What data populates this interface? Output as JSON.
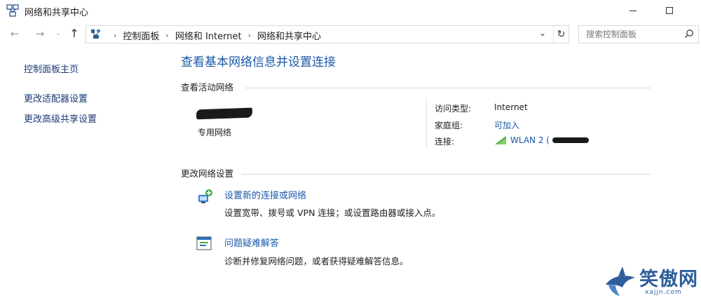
{
  "window": {
    "title": "网络和共享中心"
  },
  "address_bar": {
    "breadcrumbs": [
      "控制面板",
      "网络和 Internet",
      "网络和共享中心"
    ]
  },
  "search": {
    "placeholder": "搜索控制面板"
  },
  "left_nav": {
    "home": "控制面板主页",
    "change_adapter": "更改适配器设置",
    "change_sharing": "更改高级共享设置"
  },
  "main": {
    "title": "查看基本网络信息并设置连接",
    "active_networks_header": "查看活动网络",
    "network": {
      "type": "专用网络",
      "access_type_label": "访问类型:",
      "access_type_value": "Internet",
      "homegroup_label": "家庭组:",
      "homegroup_value": "可加入",
      "connection_label": "连接:",
      "connection_value": "WLAN 2 ("
    },
    "change_settings_header": "更改网络设置",
    "tasks": [
      {
        "link": "设置新的连接或网络",
        "description": "设置宽带、拨号或 VPN 连接；或设置路由器或接入点。",
        "icon": "new-connection-icon"
      },
      {
        "link": "问题疑难解答",
        "description": "诊断并修复网络问题，或者获得疑难解答信息。",
        "icon": "troubleshoot-icon"
      }
    ]
  },
  "watermark": {
    "text": "笑傲网",
    "sub": "xajjn.com"
  },
  "colors": {
    "link": "#1c58a8",
    "nav_link": "#1a3a73",
    "signal": "#4caa3c"
  }
}
